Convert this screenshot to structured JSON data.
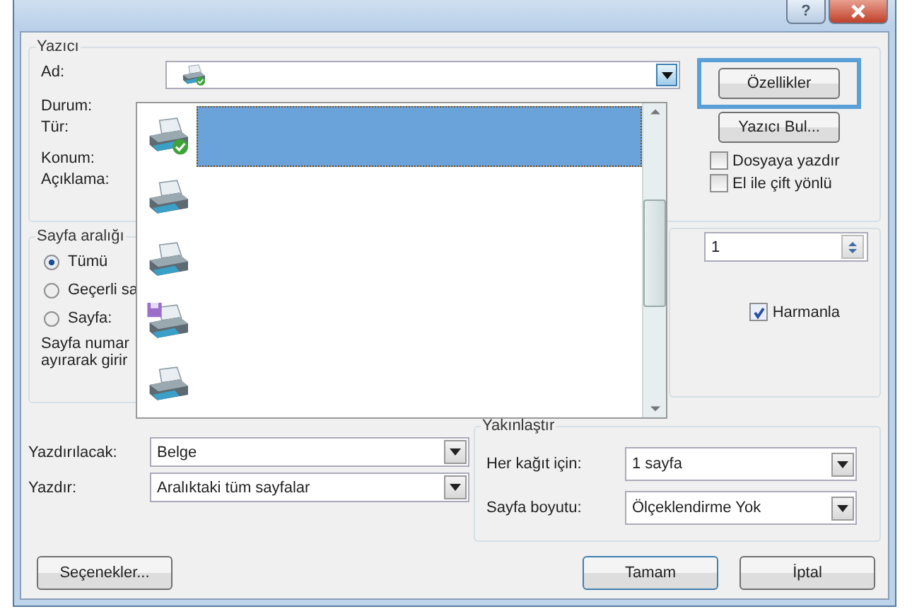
{
  "window": {
    "help_button": "?"
  },
  "printer": {
    "title": "Yazıcı",
    "labels": [
      "Ad:",
      "Durum:",
      "Tür:",
      "Konum:",
      "Açıklama:"
    ],
    "properties_button": "Özellikler",
    "find_button": "Yazıcı Bul...",
    "options": [
      {
        "label": "Dosyaya yazdır",
        "checked": false
      },
      {
        "label": "El ile çift yönlü",
        "checked": false
      }
    ]
  },
  "printer_list": [
    {
      "kind": "default",
      "selected": true
    },
    {
      "kind": "plain",
      "selected": false
    },
    {
      "kind": "plain",
      "selected": false
    },
    {
      "kind": "file",
      "selected": false
    },
    {
      "kind": "plain",
      "selected": false
    }
  ],
  "page_range": {
    "title": "Sayfa aralığı",
    "options": [
      {
        "label": "Tümü",
        "selected": true
      },
      {
        "label": "Geçerli sa",
        "selected": false
      },
      {
        "label": "Sayfa:",
        "selected": false
      }
    ],
    "hint": [
      "Sayfa numar",
      "ayırarak girir"
    ]
  },
  "copies": {
    "count": "1",
    "collate": {
      "label": "Harmanla",
      "checked": true
    }
  },
  "print_what": [
    {
      "label": "Yazdırılacak:",
      "value": "Belge"
    },
    {
      "label": "Yazdır:",
      "value": "Aralıktaki tüm sayfalar"
    }
  ],
  "zoom": {
    "title": "Yakınlaştır",
    "rows": [
      {
        "label": "Her kağıt için:",
        "value": "1 sayfa"
      },
      {
        "label": "Sayfa boyutu:",
        "value": "Ölçeklendirme Yok"
      }
    ]
  },
  "buttons": {
    "options": "Seçenekler...",
    "ok": "Tamam",
    "cancel": "İptal"
  }
}
